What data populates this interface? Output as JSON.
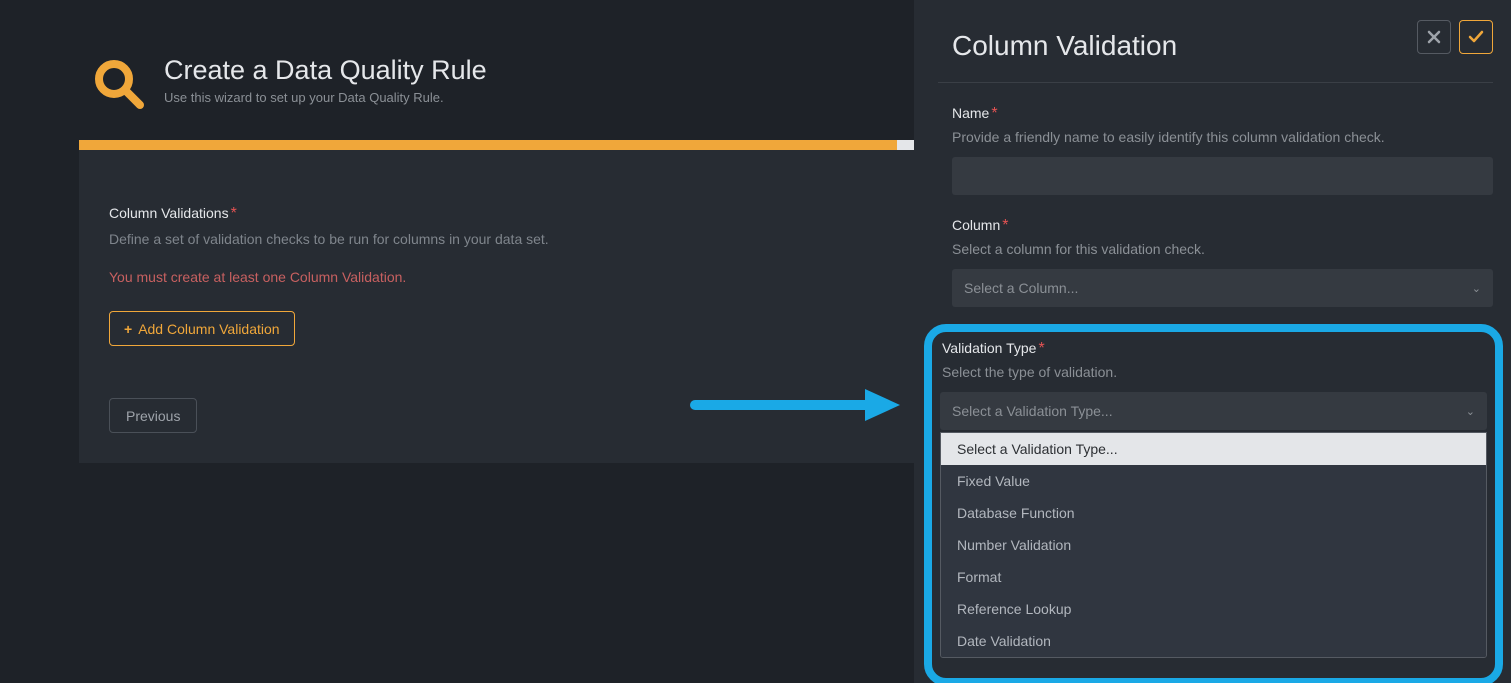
{
  "page": {
    "title": "Create a Data Quality Rule",
    "subtitle": "Use this wizard to set up your Data Quality Rule."
  },
  "progress_pct": 98,
  "section": {
    "label": "Column Validations",
    "help": "Define a set of validation checks to be run for columns in your data set.",
    "error": "You must create at least one Column Validation.",
    "add_btn": "Add Column Validation",
    "prev_btn": "Previous"
  },
  "panel": {
    "title": "Column Validation",
    "name_label": "Name",
    "name_help": "Provide a friendly name to easily identify this column validation check.",
    "name_value": "",
    "column_label": "Column",
    "column_help": "Select a column for this validation check.",
    "column_placeholder": "Select a Column...",
    "vt_label": "Validation Type",
    "vt_help": "Select the type of validation.",
    "vt_placeholder": "Select a Validation Type...",
    "vt_options": [
      "Select a Validation Type...",
      "Fixed Value",
      "Database Function",
      "Number Validation",
      "Format",
      "Reference Lookup",
      "Date Validation"
    ]
  },
  "colors": {
    "accent": "#f0a73a",
    "highlight": "#1aa9e6",
    "error": "#c76060"
  }
}
